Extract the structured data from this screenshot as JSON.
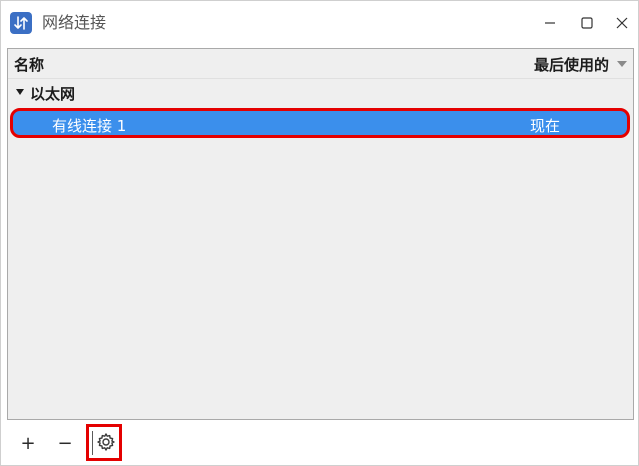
{
  "window": {
    "title": "网络连接",
    "app_icon": "up-down-arrows-icon",
    "controls": [
      "minimize-icon",
      "maximize-icon",
      "close-icon"
    ]
  },
  "list": {
    "columns": {
      "name": "名称",
      "last_used": "最后使用的"
    },
    "sort_indicator": "sort-down-arrow-icon",
    "groups": [
      {
        "label": "以太网",
        "connections": [
          {
            "name": "有线连接 1",
            "last_used": "现在",
            "selected": true
          }
        ]
      }
    ]
  },
  "toolbar": {
    "add_label": "+",
    "remove_label": "−",
    "settings_icon": "gear-icon"
  },
  "colors": {
    "selection": "#3b8fec",
    "highlight_box": "#e40000",
    "app_icon": "#3b6fc4"
  }
}
